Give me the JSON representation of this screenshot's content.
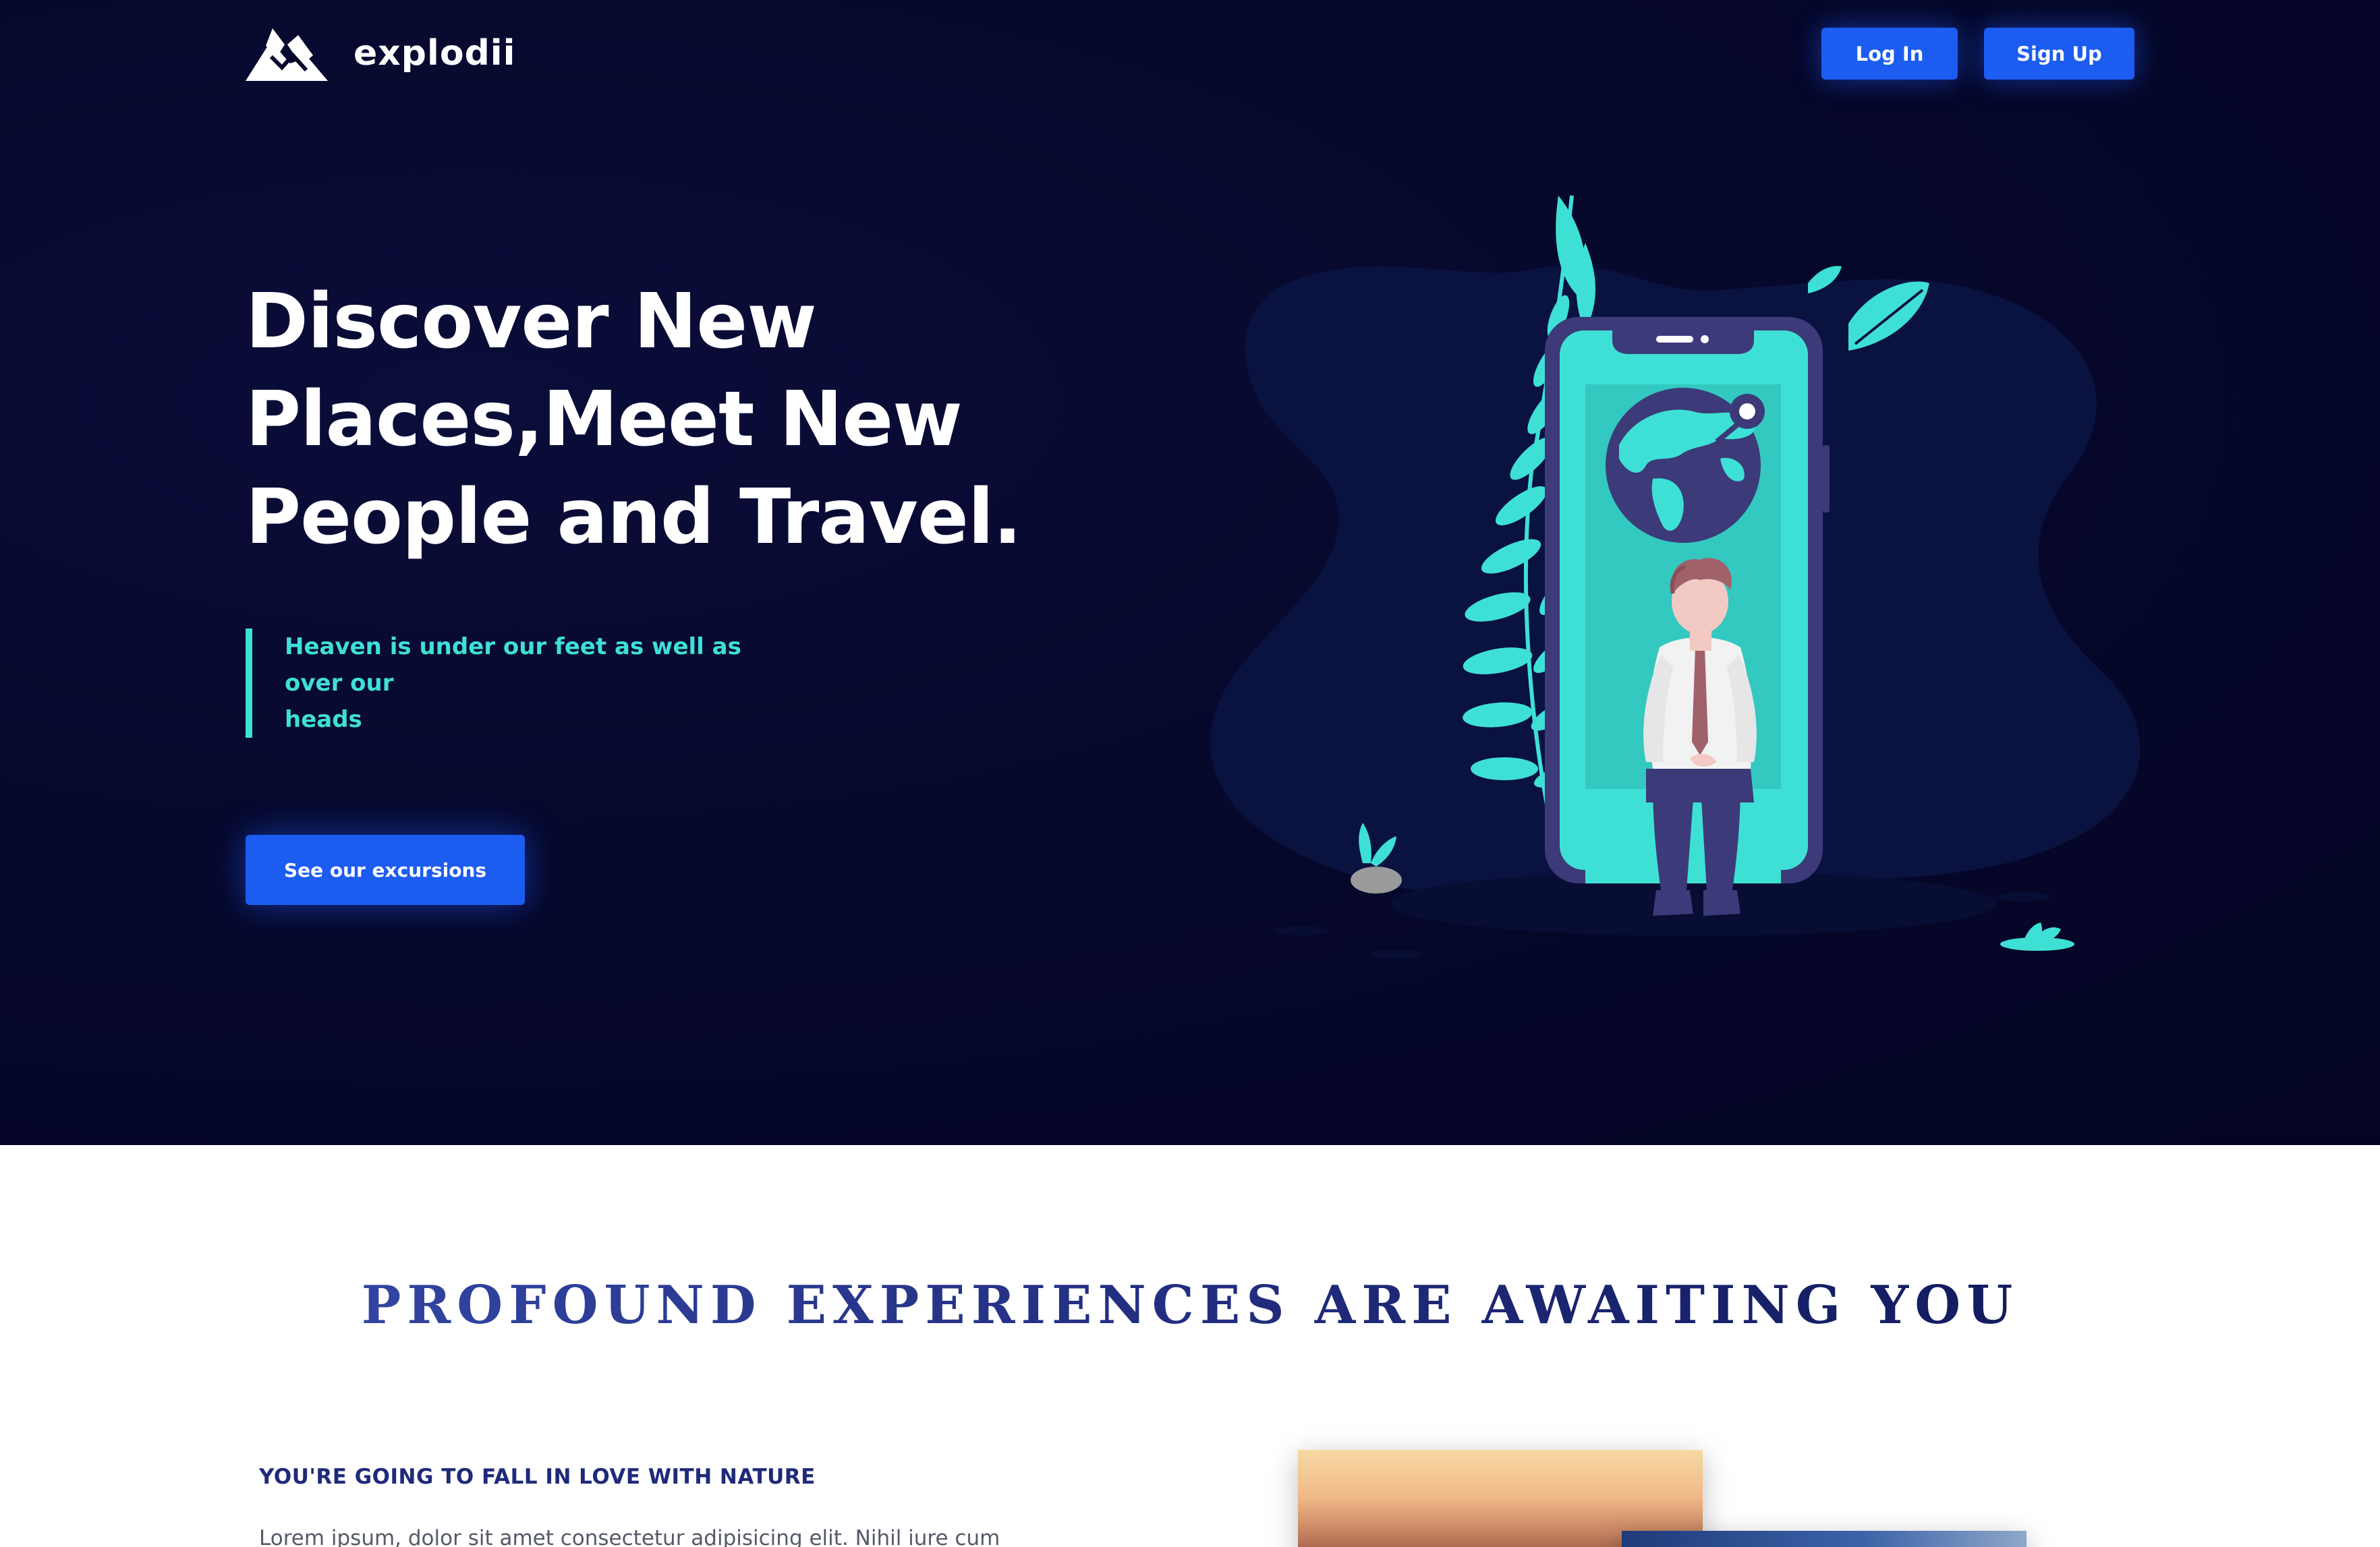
{
  "brand": {
    "name": "explodii"
  },
  "nav": {
    "login_label": "Log In",
    "signup_label": "Sign Up"
  },
  "hero": {
    "title_lines": [
      "Discover New",
      "Places,Meet New",
      "People and Travel."
    ],
    "quote_lines": [
      "Heaven is under our feet as well as over our",
      "heads"
    ],
    "cta_label": "See our excursions"
  },
  "section": {
    "title": "PROFOUND EXPERIENCES ARE AWAITING YOU",
    "subheading": "YOU'RE GOING TO FALL IN LOVE WITH NATURE",
    "body": "Lorem ipsum, dolor sit amet consectetur adipisicing elit. Nihil iure cum"
  },
  "icons": {
    "logo": "mountain-icon",
    "illustration": "person-on-phone-with-globe-illustration"
  },
  "colors": {
    "hero_bg": "#06082c",
    "accent_blue": "#1c5cf0",
    "accent_teal": "#3ee0d6",
    "heading_navy": "#1f2a7a"
  }
}
